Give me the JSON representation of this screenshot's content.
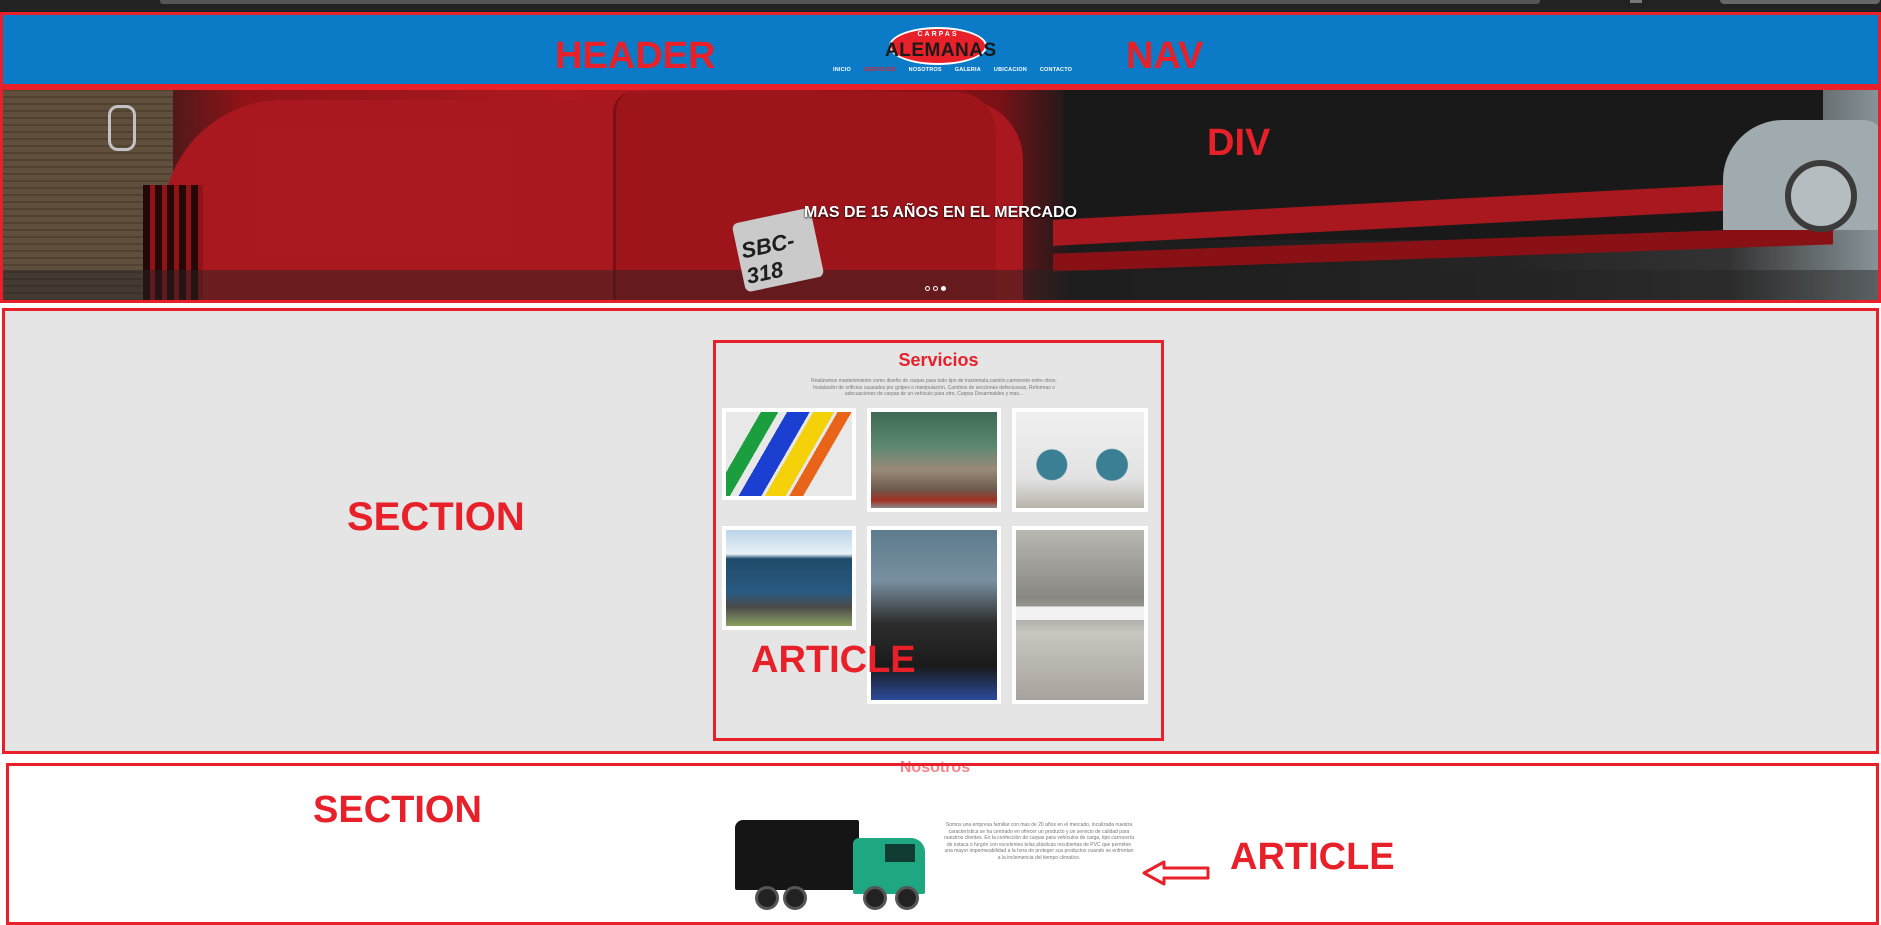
{
  "annotations": {
    "header": "HEADER",
    "nav": "NAV",
    "div": "DIV",
    "section_services": "SECTION",
    "article_services": "ARTICLE",
    "section_nosotros": "SECTION",
    "article_nosotros": "ARTICLE",
    "color": "#e8202a"
  },
  "header": {
    "logo_small": "CARPAS",
    "logo_big": "ALEMANAS",
    "nav": [
      "INICIO",
      "SERVICIOS",
      "NOSOTROS",
      "GALERIA",
      "UBICACION",
      "CONTACTO"
    ],
    "active_index": 1,
    "background": "#0b7bc7"
  },
  "hero": {
    "slogan": "MAS DE 15 AÑOS EN EL MERCADO",
    "plate": "SBC-318",
    "slides": 3,
    "active_slide": 3
  },
  "services": {
    "title": "Servicios",
    "text": "Realizamos mantenimiento como diseño de carpas para todo tipo de tractomula,camión,camionete entre otros. Instalación de orificios causados por golpes o manipulación, Cambios de secciones defectuosas, Reformas o adecuaciones de carpas de un vehículo para otro, Carpas Desarmables y mas...",
    "photos": [
      "pvc-rolls",
      "warehouse-frame",
      "welding-machines",
      "covered-truck",
      "worker-sewing",
      "sewing-machine"
    ]
  },
  "nosotros": {
    "title": "Nosotros",
    "text": "Somos una empresa familiar con mas de 20 años en el mercado, localizada nuestra característica se ha centrado en ofrecer un producto y un servicio de calidad para nuestros clientes. En la confección de carpas para vehículos de carga, tipo carrocería de estaca o furgón con excelentes telas plásticas recubiertas de PVC que permiten una mayor impermeabilidad a la hora de proteger sus productos cuando se enfrentan a la inclemencia del tiempo climatico."
  }
}
